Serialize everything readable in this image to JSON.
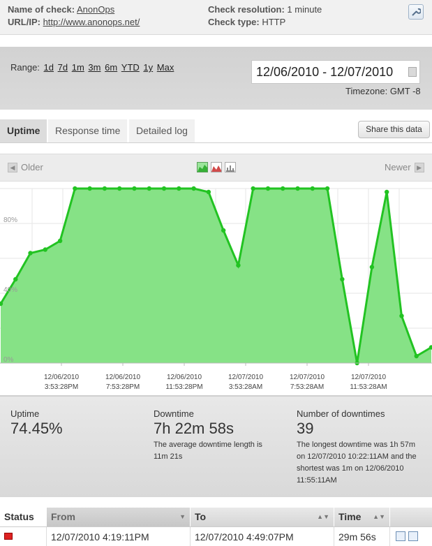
{
  "info": {
    "name_label": "Name of check:",
    "name_value": "AnonOps",
    "url_label": "URL/IP:",
    "url_value": "http://www.anonops.net/",
    "resolution_label": "Check resolution:",
    "resolution_value": "1 minute",
    "type_label": "Check type:",
    "type_value": "HTTP",
    "settings_icon": "wrench-icon"
  },
  "range": {
    "label": "Range:",
    "options": [
      "1d",
      "7d",
      "1m",
      "3m",
      "6m",
      "YTD",
      "1y",
      "Max"
    ],
    "date_range": "12/06/2010 - 12/07/2010",
    "timezone": "Timezone: GMT -8"
  },
  "tabs": [
    "Uptime",
    "Response time",
    "Detailed log"
  ],
  "share_label": "Share this data",
  "chart_nav": {
    "older": "Older",
    "newer": "Newer"
  },
  "chart_data": {
    "type": "area",
    "y_ticks": [
      "0%",
      "40%",
      "80%"
    ],
    "ylim": [
      0,
      100
    ],
    "grid": true,
    "x_tick_labels": [
      [
        "12/06/2010",
        "3:53:28PM"
      ],
      [
        "12/06/2010",
        "7:53:28PM"
      ],
      [
        "12/06/2010",
        "11:53:28PM"
      ],
      [
        "12/07/2010",
        "3:53:28AM"
      ],
      [
        "12/07/2010",
        "7:53:28AM"
      ],
      [
        "12/07/2010",
        "11:53:28AM"
      ]
    ],
    "series": [
      {
        "color": "#22c322",
        "fill": "#86e286",
        "values": [
          34,
          48,
          63,
          65,
          70,
          100,
          100,
          100,
          100,
          100,
          100,
          100,
          100,
          100,
          98,
          76,
          56,
          100,
          100,
          100,
          100,
          100,
          100,
          48,
          0,
          55,
          98,
          27,
          4,
          9
        ]
      }
    ]
  },
  "stats": {
    "uptime_label": "Uptime",
    "uptime_value": "74.45%",
    "downtime_label": "Downtime",
    "downtime_value": "7h 22m 58s",
    "downtime_desc_1": "The average downtime length is",
    "downtime_desc_2": "11m 21s",
    "count_label": "Number of downtimes",
    "count_value": "39",
    "count_desc_1": "The longest downtime was 1h 57m",
    "count_desc_2": "on 12/07/2010 10:22:11AM and the",
    "count_desc_3": "shortest was 1m on 12/06/2010",
    "count_desc_4": "11:55:11AM"
  },
  "table": {
    "headers": {
      "status": "Status",
      "from": "From",
      "to": "To",
      "time": "Time"
    },
    "rows": [
      {
        "status": "down",
        "from": "12/07/2010 4:19:11PM",
        "to": "12/07/2010 4:49:07PM",
        "time": "29m 56s"
      }
    ]
  }
}
